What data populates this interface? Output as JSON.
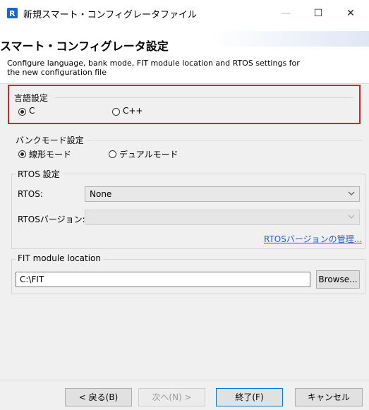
{
  "window": {
    "title": "新規スマート・コンフィグレータファイル",
    "minimize": "—",
    "maximize": "☐",
    "close": "✕"
  },
  "header": {
    "banner_title": "スマート・コンフィグレータ設定",
    "description": "Configure language, bank mode, FIT module location and RTOS settings for the new configuration file"
  },
  "language": {
    "group_label": "言語設定",
    "options": [
      {
        "label": "C",
        "selected": true
      },
      {
        "label": "C++",
        "selected": false
      }
    ]
  },
  "bank_mode": {
    "group_label": "バンクモード設定",
    "options": [
      {
        "label": "線形モード",
        "selected": true
      },
      {
        "label": "デュアルモード",
        "selected": false
      }
    ]
  },
  "rtos": {
    "group_label": "RTOS 設定",
    "rtos_label": "RTOS:",
    "rtos_value": "None",
    "version_label": "RTOSバージョン:",
    "version_value": "",
    "manage_link": "RTOSバージョンの管理..."
  },
  "fit": {
    "group_label": "FIT module location",
    "path_value": "C:\\FIT",
    "browse_label": "Browse..."
  },
  "buttons": {
    "back": "< 戻る(B)",
    "next": "次へ(N) >",
    "finish": "終了(F)",
    "cancel": "キャンセル"
  },
  "colors": {
    "highlight_border": "#e31c23",
    "link": "#1f5fbf",
    "app_icon": "#1c64c8"
  },
  "icons": [
    "renesas-app-icon",
    "chevron-down-icon"
  ]
}
